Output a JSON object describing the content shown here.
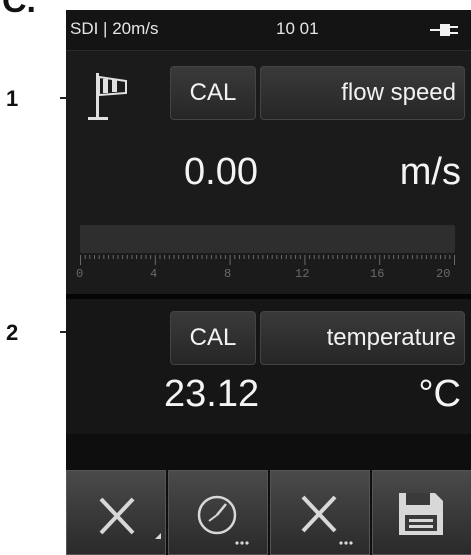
{
  "figure_letter": "C.",
  "callouts": [
    "1",
    "2"
  ],
  "status": {
    "left": "SDI | 20m/s",
    "time": "10 01",
    "icon": "plug-icon"
  },
  "channel1": {
    "icon": "windsock-icon",
    "cal_label": "CAL",
    "name": "flow speed",
    "value": "0.00",
    "unit": "m/s",
    "scale": {
      "labels": [
        "0",
        "4",
        "8",
        "12",
        "16",
        "20"
      ],
      "min": 0,
      "max": 20,
      "level": 0.0
    }
  },
  "channel2": {
    "cal_label": "CAL",
    "name": "temperature",
    "value": "23.12",
    "unit": "°C"
  },
  "toolbar": {
    "buttons": [
      {
        "icon": "close-icon",
        "label": ""
      },
      {
        "icon": "clock-icon",
        "label": ""
      },
      {
        "icon": "close-icon",
        "label": ""
      },
      {
        "icon": "save-icon",
        "label": ""
      }
    ]
  }
}
